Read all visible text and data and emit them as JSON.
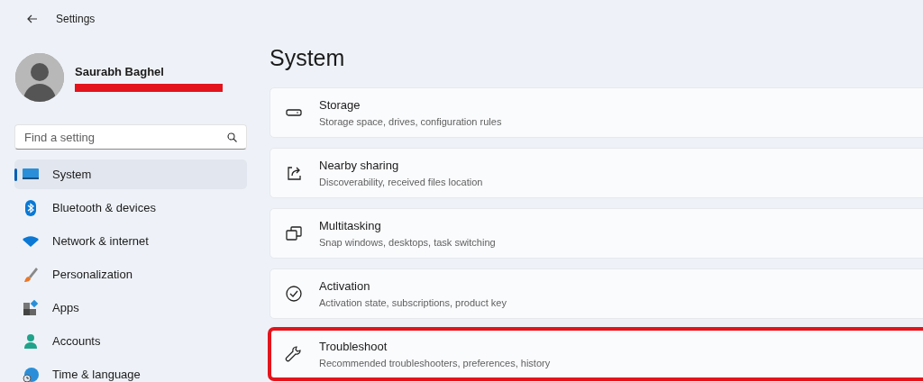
{
  "window": {
    "title": "Settings"
  },
  "profile": {
    "name": "Saurabh Baghel",
    "email_redacted": true
  },
  "search": {
    "placeholder": "Find a setting"
  },
  "sidebar": {
    "items": [
      {
        "label": "System",
        "kind": "system",
        "selected": true
      },
      {
        "label": "Bluetooth & devices",
        "kind": "bluetooth",
        "selected": false
      },
      {
        "label": "Network & internet",
        "kind": "network",
        "selected": false
      },
      {
        "label": "Personalization",
        "kind": "personalization",
        "selected": false
      },
      {
        "label": "Apps",
        "kind": "apps",
        "selected": false
      },
      {
        "label": "Accounts",
        "kind": "accounts",
        "selected": false
      },
      {
        "label": "Time & language",
        "kind": "time",
        "selected": false
      }
    ]
  },
  "page": {
    "title": "System"
  },
  "settings": [
    {
      "title": "Storage",
      "description": "Storage space, drives, configuration rules",
      "kind": "storage",
      "highlighted": false
    },
    {
      "title": "Nearby sharing",
      "description": "Discoverability, received files location",
      "kind": "sharing",
      "highlighted": false
    },
    {
      "title": "Multitasking",
      "description": "Snap windows, desktops, task switching",
      "kind": "multitasking",
      "highlighted": false
    },
    {
      "title": "Activation",
      "description": "Activation state, subscriptions, product key",
      "kind": "activation",
      "highlighted": false
    },
    {
      "title": "Troubleshoot",
      "description": "Recommended troubleshooters, preferences, history",
      "kind": "troubleshoot",
      "highlighted": true
    }
  ]
}
